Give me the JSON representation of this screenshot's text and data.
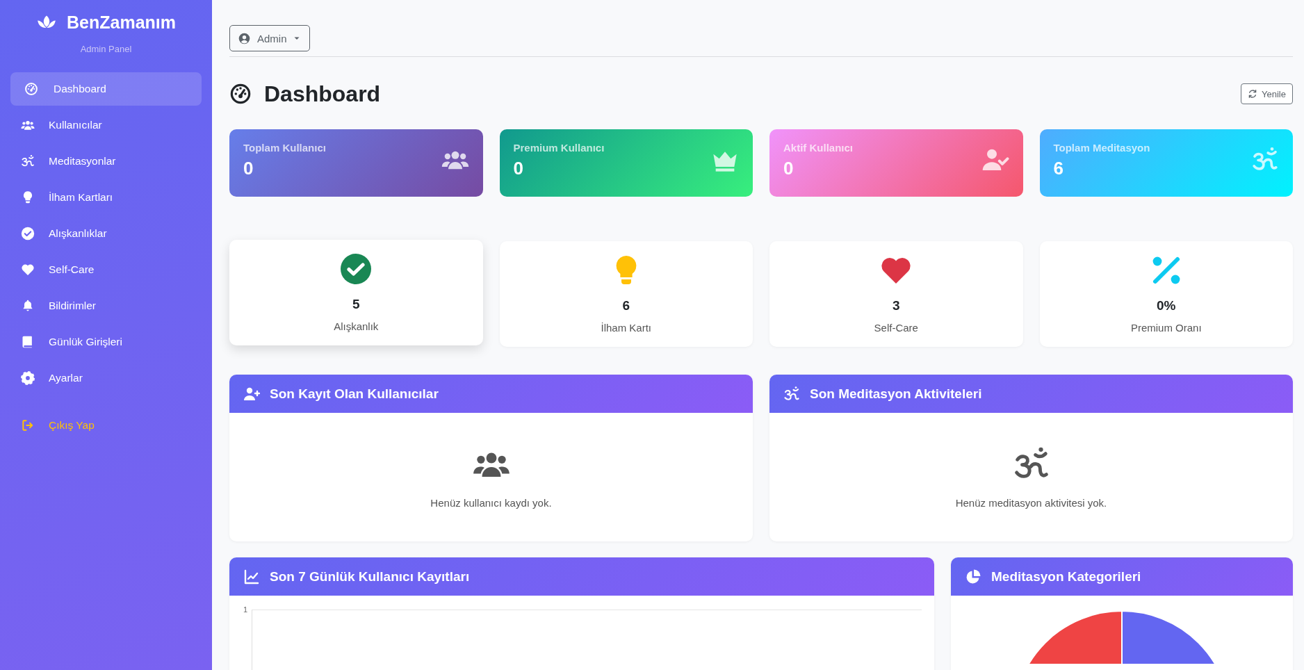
{
  "brand": {
    "name": "BenZamanım",
    "subtitle": "Admin Panel"
  },
  "sidebar": {
    "items": [
      {
        "label": "Dashboard",
        "kind": "gauge",
        "selected": true
      },
      {
        "label": "Kullanıcılar",
        "kind": "users",
        "selected": false
      },
      {
        "label": "Meditasyonlar",
        "kind": "om",
        "selected": false
      },
      {
        "label": "İlham Kartları",
        "kind": "bulb",
        "selected": false
      },
      {
        "label": "Alışkanlıklar",
        "kind": "check",
        "selected": false
      },
      {
        "label": "Self-Care",
        "kind": "heart",
        "selected": false
      },
      {
        "label": "Bildirimler",
        "kind": "bell",
        "selected": false
      },
      {
        "label": "Günlük Girişleri",
        "kind": "book",
        "selected": false
      },
      {
        "label": "Ayarlar",
        "kind": "gear",
        "selected": false
      }
    ],
    "logout": "Çıkış Yap"
  },
  "user_menu": "Admin",
  "page_title": "Dashboard",
  "refresh_button": "Yenile",
  "stat_cards": [
    {
      "label": "Toplam Kullanıcı",
      "value": "0",
      "kind": "users"
    },
    {
      "label": "Premium Kullanıcı",
      "value": "0",
      "kind": "crown"
    },
    {
      "label": "Aktif Kullanıcı",
      "value": "0",
      "kind": "user-check"
    },
    {
      "label": "Toplam Meditasyon",
      "value": "6",
      "kind": "om"
    }
  ],
  "summary_cards": [
    {
      "value": "5",
      "label": "Alışkanlık",
      "kind": "check"
    },
    {
      "value": "6",
      "label": "İlham Kartı",
      "kind": "bulb"
    },
    {
      "value": "3",
      "label": "Self-Care",
      "kind": "heart"
    },
    {
      "value": "0%",
      "label": "Premium Oranı",
      "kind": "percent"
    }
  ],
  "panels": [
    {
      "title": "Son Kayıt Olan Kullanıcılar",
      "kind": "users",
      "empty_text": "Henüz kullanıcı kaydı yok."
    },
    {
      "title": "Son Meditasyon Aktiviteleri",
      "kind": "om",
      "empty_text": "Henüz meditasyon aktivitesi yok."
    }
  ],
  "line_chart_panel": {
    "title": "Son 7 Günlük Kullanıcı Kayıtları",
    "y_tick": "1"
  },
  "pie_chart_panel": {
    "title": "Meditasyon Kategorileri"
  }
}
